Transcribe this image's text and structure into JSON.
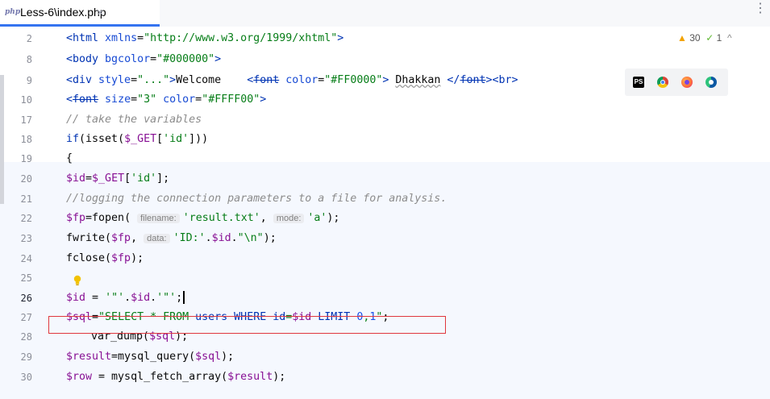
{
  "tab": {
    "badge": "php",
    "title": "Less-6\\index.php",
    "close": "×"
  },
  "menu": {
    "dots": "⋮"
  },
  "inspections": {
    "warnings": "30",
    "checks": "1"
  },
  "lines": [
    {
      "n": "2"
    },
    {
      "n": "8"
    },
    {
      "n": "9"
    },
    {
      "n": "10"
    },
    {
      "n": "17"
    },
    {
      "n": "18"
    },
    {
      "n": "19"
    },
    {
      "n": "20"
    },
    {
      "n": "21"
    },
    {
      "n": "22"
    },
    {
      "n": "23"
    },
    {
      "n": "24"
    },
    {
      "n": "25"
    },
    {
      "n": "26"
    },
    {
      "n": "27"
    },
    {
      "n": "28"
    },
    {
      "n": "29"
    },
    {
      "n": "30"
    }
  ],
  "code": {
    "l2": {
      "a": "<html ",
      "b": "xmlns",
      "c": "=",
      "d": "\"http://www.w3.org/1999/xhtml\"",
      "e": ">"
    },
    "l8": {
      "a": "<body ",
      "b": "bgcolor",
      "c": "=",
      "d": "\"#000000\"",
      "e": ">"
    },
    "l9": {
      "a": "<div ",
      "b": "style",
      "c": "=",
      "d": "\"...\"",
      "e": ">",
      "f": "Welcome    ",
      "g": "<",
      "h": "font",
      "i": " color",
      "j": "=",
      "k": "\"#FF0000\"",
      "l": "> ",
      "m": "Dhakkan",
      "n": " </",
      "o": "font",
      "p": "><br>"
    },
    "l10": {
      "a": "<",
      "b": "font",
      "c": " size",
      "d": "=",
      "e": "\"3\"",
      "f": " color",
      "g": "=",
      "h": "\"#FFFF00\"",
      "i": ">"
    },
    "l17": "// take the variables",
    "l18": {
      "a": "if",
      "b": "(",
      "c": "isset",
      "d": "(",
      "e": "$_GET",
      "f": "[",
      "g": "'id'",
      "h": "]))"
    },
    "l19": "{",
    "l20": {
      "a": "$id",
      "b": "=",
      "c": "$_GET",
      "d": "[",
      "e": "'id'",
      "f": "];"
    },
    "l21": "//logging the connection parameters to a file for analysis.",
    "l22": {
      "a": "$fp",
      "b": "=fopen( ",
      "c": "filename:",
      "d": "'result.txt'",
      "e": ", ",
      "f": "mode:",
      "g": "'a'",
      "h": ");"
    },
    "l23": {
      "a": "fwrite(",
      "b": "$fp",
      "c": ", ",
      "d": "data:",
      "e": "'ID:'",
      "f": ".",
      "g": "$id",
      "h": ".",
      "i": "\"\\n\"",
      "j": ");"
    },
    "l24": {
      "a": "fclose(",
      "b": "$fp",
      "c": ");"
    },
    "l26": {
      "a": "$id",
      "b": " = ",
      "c": "'\"'",
      "d": ".",
      "e": "$id",
      "f": ".",
      "g": "'\"'",
      "h": ";"
    },
    "l27": {
      "a": "$sql",
      "b": "=",
      "c": "\"SELECT * FROM ",
      "d": "users",
      "e": " WHERE ",
      "f": "id",
      "g": "=",
      "h": "$id",
      "i": " LIMIT ",
      "j": "0",
      "k": ",",
      "l": "1",
      "m": "\"",
      "n": ";"
    },
    "l28": {
      "a": "var_dump(",
      "b": "$sql",
      "c": ");"
    },
    "l29": {
      "a": "$result",
      "b": "=mysql_query(",
      "c": "$sql",
      "d": ");"
    },
    "l30": {
      "a": "$row",
      "b": " = mysql_fetch_array(",
      "c": "$result",
      "d": ");"
    }
  },
  "browsers": [
    {
      "name": "phpstorm-icon",
      "label": "PS"
    },
    {
      "name": "chrome-icon",
      "label": ""
    },
    {
      "name": "firefox-icon",
      "label": ""
    },
    {
      "name": "edge-icon",
      "label": ""
    }
  ]
}
